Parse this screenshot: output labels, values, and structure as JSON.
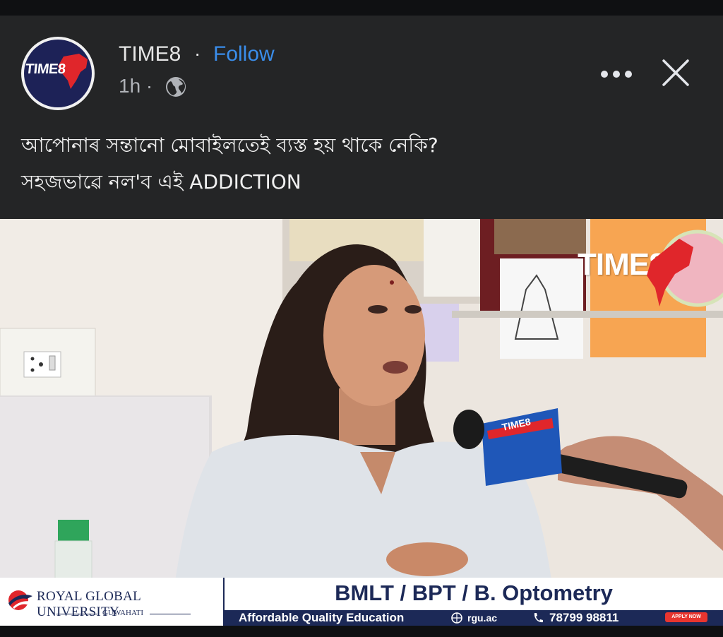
{
  "post": {
    "page_name": "TIME8",
    "separator": "·",
    "follow_label": "Follow",
    "timestamp": "1h ·",
    "privacy_icon": "globe-icon",
    "more_icon": "more-options-icon",
    "close_icon": "close-icon",
    "avatar_logo": "TIME8",
    "caption_line1": "আপোনাৰ সন্তানো মোবাইলতেই ব্যস্ত হয় থাকে নেকি?",
    "caption_line2": "সহজভাৱে নল'ব এই ADDICTION"
  },
  "media": {
    "watermark": "TIME8",
    "mic_label": "TIME8"
  },
  "ad_banner": {
    "university_name": "ROYAL GLOBAL UNIVERSITY",
    "university_city": "GUWAHATI",
    "courses": "BMLT / BPT / B. Optometry",
    "tagline": "Affordable Quality Education",
    "website": "rgu.ac",
    "phone": "78799 98811",
    "apply_label": "APPLY NOW"
  },
  "colors": {
    "background": "#242526",
    "follow": "#3a8dea",
    "brand_navy": "#1c2957",
    "brand_red": "#e0262b"
  }
}
